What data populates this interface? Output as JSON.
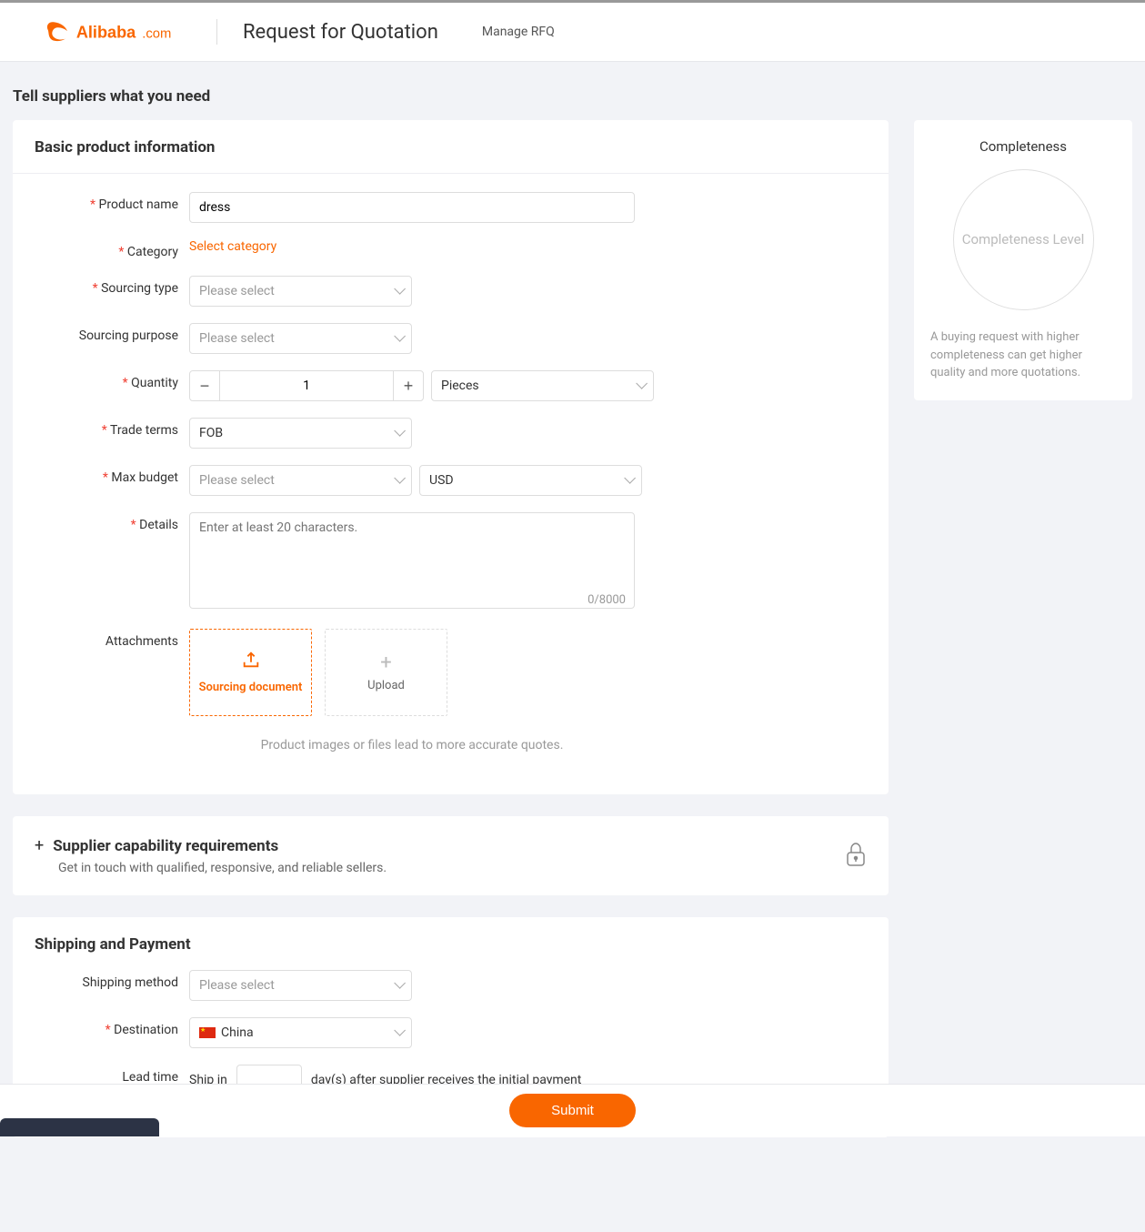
{
  "header": {
    "brand": "Alibaba.com",
    "page_title": "Request for Quotation",
    "manage_link": "Manage RFQ"
  },
  "heading": "Tell suppliers what you need",
  "basic": {
    "title": "Basic product information",
    "product_name_label": "Product name",
    "product_name_value": "dress",
    "category_label": "Category",
    "category_action": "Select category",
    "sourcing_type_label": "Sourcing type",
    "sourcing_type_placeholder": "Please select",
    "sourcing_purpose_label": "Sourcing purpose",
    "sourcing_purpose_placeholder": "Please select",
    "quantity_label": "Quantity",
    "quantity_value": "1",
    "quantity_unit": "Pieces",
    "trade_terms_label": "Trade terms",
    "trade_terms_value": "FOB",
    "max_budget_label": "Max budget",
    "max_budget_placeholder": "Please select",
    "max_budget_currency": "USD",
    "details_label": "Details",
    "details_placeholder": "Enter at least 20 characters.",
    "details_counter": "0/8000",
    "attachments_label": "Attachments",
    "attach_sourcing": "Sourcing document",
    "attach_upload": "Upload",
    "attach_hint": "Product images or files lead to more accurate quotes."
  },
  "supplier": {
    "title": "Supplier capability requirements",
    "subtitle": "Get in touch with qualified, responsive, and reliable sellers."
  },
  "shipping": {
    "title": "Shipping and Payment",
    "method_label": "Shipping method",
    "method_placeholder": "Please select",
    "destination_label": "Destination",
    "destination_value": "China",
    "leadtime_label": "Lead time",
    "leadtime_prefix": "Ship in",
    "leadtime_value": "",
    "leadtime_suffix": "day(s) after supplier receives the initial payment"
  },
  "sidebar": {
    "title": "Completeness",
    "circle_text": "Completeness Level",
    "note": "A buying request with higher completeness can get higher quality and more quotations."
  },
  "footer": {
    "submit": "Submit"
  }
}
